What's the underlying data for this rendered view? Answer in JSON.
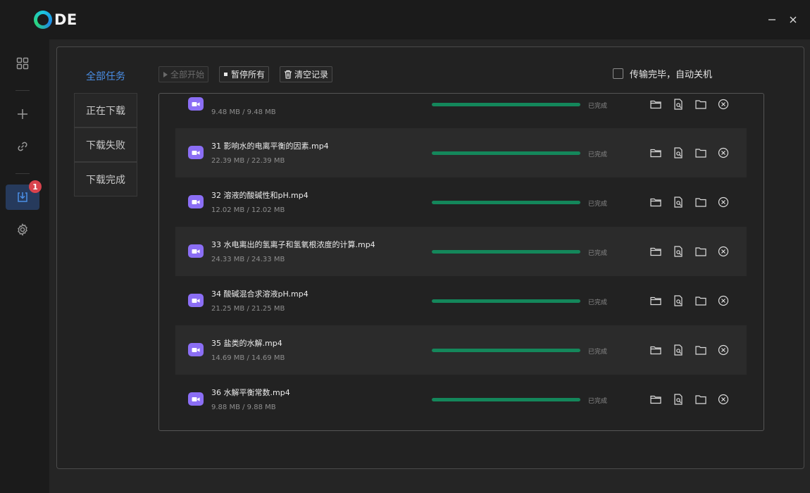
{
  "app": {
    "logo_text": "DE"
  },
  "window_controls": [
    "minimize-icon",
    "close-icon"
  ],
  "rail": {
    "items": [
      {
        "icon": "grid-icon"
      },
      {
        "icon": "plus-icon"
      },
      {
        "icon": "link-icon"
      },
      {
        "icon": "download-icon",
        "badge": "1",
        "active": true
      },
      {
        "icon": "gear-icon"
      }
    ]
  },
  "tabs": [
    "全部任务",
    "正在下载",
    "下载失败",
    "下载完成"
  ],
  "toolbar": {
    "start_all": "全部开始",
    "pause_all": "暂停所有",
    "clear_records": "清空记录",
    "auto_shutdown_label": "传输完毕，自动关机",
    "auto_shutdown_checked": false
  },
  "colors": {
    "accent": "#4a8fe7",
    "progress": "#14875b",
    "file_icon": "#8b6ef5",
    "badge": "#d9434d"
  },
  "downloads": [
    {
      "name": "",
      "size": "9.48 MB / 9.48 MB",
      "status": "已完成",
      "progress": 1.0
    },
    {
      "name": "31 影响水的电离平衡的因素.mp4",
      "size": "22.39 MB / 22.39 MB",
      "status": "已完成",
      "progress": 1.0
    },
    {
      "name": "32 溶液的酸碱性和pH.mp4",
      "size": "12.02 MB / 12.02 MB",
      "status": "已完成",
      "progress": 1.0
    },
    {
      "name": "33 水电离出的氢离子和氢氧根浓度的计算.mp4",
      "size": "24.33 MB / 24.33 MB",
      "status": "已完成",
      "progress": 1.0
    },
    {
      "name": "34 酸碱混合求溶液pH.mp4",
      "size": "21.25 MB / 21.25 MB",
      "status": "已完成",
      "progress": 1.0
    },
    {
      "name": "35 盐类的水解.mp4",
      "size": "14.69 MB / 14.69 MB",
      "status": "已完成",
      "progress": 1.0
    },
    {
      "name": "36 水解平衡常数.mp4",
      "size": "9.88 MB / 9.88 MB",
      "status": "已完成",
      "progress": 1.0
    }
  ]
}
